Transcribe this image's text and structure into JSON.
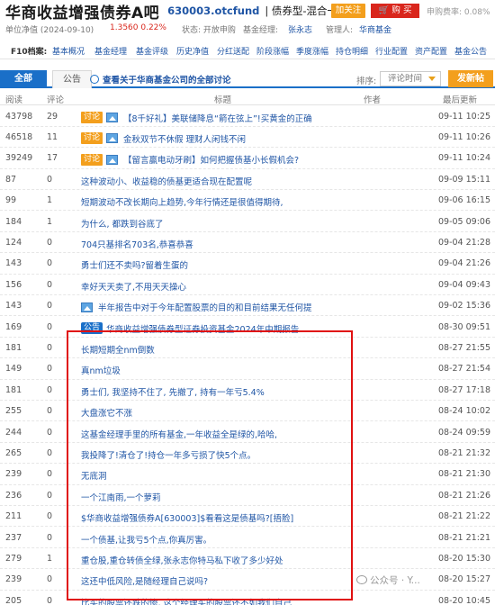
{
  "header": {
    "fund_name": "华商收益增强债券A吧",
    "fund_code": "630003.otcfund",
    "fund_type": "| 债券型-混合一级",
    "follow_label": "加关注",
    "buy_label": "购 买",
    "fee_label": "申购费率:",
    "fee_value": "0.08%"
  },
  "nav_line": {
    "nav_label": "单位净值 (2024-09-10)",
    "nav_value": "1.3560 0.22%",
    "status": "状态: 开放申购",
    "manager_label": "基金经理:",
    "manager": "张永志",
    "company_label": "管理人:",
    "company": "华商基金"
  },
  "f10": {
    "label": "F10档案:",
    "items": [
      "基本概况",
      "基金经理",
      "基金评级",
      "历史净值",
      "分红送配",
      "阶段涨幅",
      "季度涨幅",
      "持仓明细",
      "行业配置",
      "资产配置",
      "基金公告"
    ]
  },
  "tabs": {
    "all": "全部",
    "notice": "公告",
    "discuss_link": "查看关于华商基金公司的全部讨论",
    "sort_label": "排序:",
    "sort_value": "评论时间",
    "post_button": "发新帖"
  },
  "table": {
    "headers": {
      "read": "阅读",
      "comment": "评论",
      "title": "标题",
      "author": "作者",
      "time": "最后更新"
    },
    "rows": [
      {
        "read": "43798",
        "comment": "29",
        "tag": "讨论",
        "image": true,
        "title": "【8千好礼】美联储降息“箭在弦上”!买黄金的正确",
        "author": "",
        "time": "09-11 10:25"
      },
      {
        "read": "46518",
        "comment": "11",
        "tag": "讨论",
        "image": true,
        "title": "金秋双节不休假 理财人闲钱不闲",
        "author": "",
        "time": "09-11 10:26"
      },
      {
        "read": "39249",
        "comment": "17",
        "tag": "讨论",
        "image": true,
        "title": "【留言赢电动牙刷】如何把握债基小长假机会?",
        "author": "",
        "time": "09-11 10:24"
      },
      {
        "read": "87",
        "comment": "0",
        "tag": "",
        "image": false,
        "title": "这种波动小、收益稳的债基更适合现在配置呢",
        "author": "",
        "time": "09-09 15:11"
      },
      {
        "read": "99",
        "comment": "1",
        "tag": "",
        "image": false,
        "title": "短期波动不改长期向上趋势,今年行情还是很值得期待,",
        "author": "",
        "time": "09-06 16:15"
      },
      {
        "read": "184",
        "comment": "1",
        "tag": "",
        "image": false,
        "title": "为什么, 都跌到谷底了",
        "author": "",
        "time": "09-05 09:06"
      },
      {
        "read": "124",
        "comment": "0",
        "tag": "",
        "image": false,
        "title": "704只基排名703名,恭喜恭喜",
        "author": "",
        "time": "09-04 21:28"
      },
      {
        "read": "143",
        "comment": "0",
        "tag": "",
        "image": false,
        "title": "勇士们还不卖吗?留着生蛋的",
        "author": "",
        "time": "09-04 21:26"
      },
      {
        "read": "156",
        "comment": "0",
        "tag": "",
        "image": false,
        "title": "幸好天天卖了,不用天天操心",
        "author": "",
        "time": "09-04 09:43"
      },
      {
        "read": "143",
        "comment": "0",
        "tag": "",
        "image": true,
        "title": "半年报告中对于今年配置股票的目的和目前结果无任何提",
        "author": "",
        "time": "09-02 15:36"
      },
      {
        "read": "169",
        "comment": "0",
        "tag": "公告",
        "image": false,
        "title": "华商收益增强债券型证券投资基金2024年中期报告",
        "author": "",
        "time": "08-30 09:51"
      },
      {
        "read": "181",
        "comment": "0",
        "tag": "",
        "image": false,
        "title": "长期短期全nm倒数",
        "author": "",
        "time": "08-27 21:55"
      },
      {
        "read": "149",
        "comment": "0",
        "tag": "",
        "image": false,
        "title": "真nm垃圾",
        "author": "",
        "time": "08-27 21:54"
      },
      {
        "read": "181",
        "comment": "0",
        "tag": "",
        "image": false,
        "title": "勇士们, 我坚持不住了, 先撤了, 持有一年亏5.4%",
        "author": "",
        "time": "08-27 17:18"
      },
      {
        "read": "255",
        "comment": "0",
        "tag": "",
        "image": false,
        "title": "大盘涨它不涨",
        "author": "",
        "time": "08-24 10:02"
      },
      {
        "read": "244",
        "comment": "0",
        "tag": "",
        "image": false,
        "title": "这基金经理手里的所有基金,一年收益全是绿的,哈哈,",
        "author": "",
        "time": "08-24 09:59"
      },
      {
        "read": "265",
        "comment": "0",
        "tag": "",
        "image": false,
        "title": "我投降了!清仓了!持仓一年多亏损了快5个点。",
        "author": "",
        "time": "08-21 21:32"
      },
      {
        "read": "239",
        "comment": "0",
        "tag": "",
        "image": false,
        "title": "无底洞",
        "author": "",
        "time": "08-21 21:30"
      },
      {
        "read": "236",
        "comment": "0",
        "tag": "",
        "image": false,
        "title": "一个江南雨,一个萝莉",
        "author": "",
        "time": "08-21 21:26"
      },
      {
        "read": "211",
        "comment": "0",
        "tag": "",
        "image": false,
        "title": "$华商收益增强债券A[630003]$看看这是债基吗?[捂脸]",
        "author": "",
        "time": "08-21 21:22"
      },
      {
        "read": "237",
        "comment": "0",
        "tag": "",
        "image": false,
        "title": "一个债基,让我亏5个点,你真厉害。",
        "author": "",
        "time": "08-21 21:21"
      },
      {
        "read": "279",
        "comment": "1",
        "tag": "",
        "image": false,
        "title": "重仓股,重仓转债全绿,张永志你特马私下收了多少好处",
        "author": "",
        "time": "08-20 15:30"
      },
      {
        "read": "239",
        "comment": "0",
        "tag": "",
        "image": false,
        "title": "这还中低风险,是随经理自己说吗?",
        "author": "",
        "time": "08-20 15:27"
      },
      {
        "read": "205",
        "comment": "0",
        "tag": "",
        "image": false,
        "title": "比买的股票还跌的惨, 这个经理买的股票还不如我们自己",
        "author": "",
        "time": "08-20 10:45"
      }
    ]
  },
  "watermark": {
    "text": "公众号 · Y..."
  },
  "colors": {
    "accent_blue": "#1a6fc8",
    "link_blue": "#1f55a5",
    "orange": "#f39f1d",
    "red": "#d9261c",
    "highlight_red": "#e01010"
  }
}
